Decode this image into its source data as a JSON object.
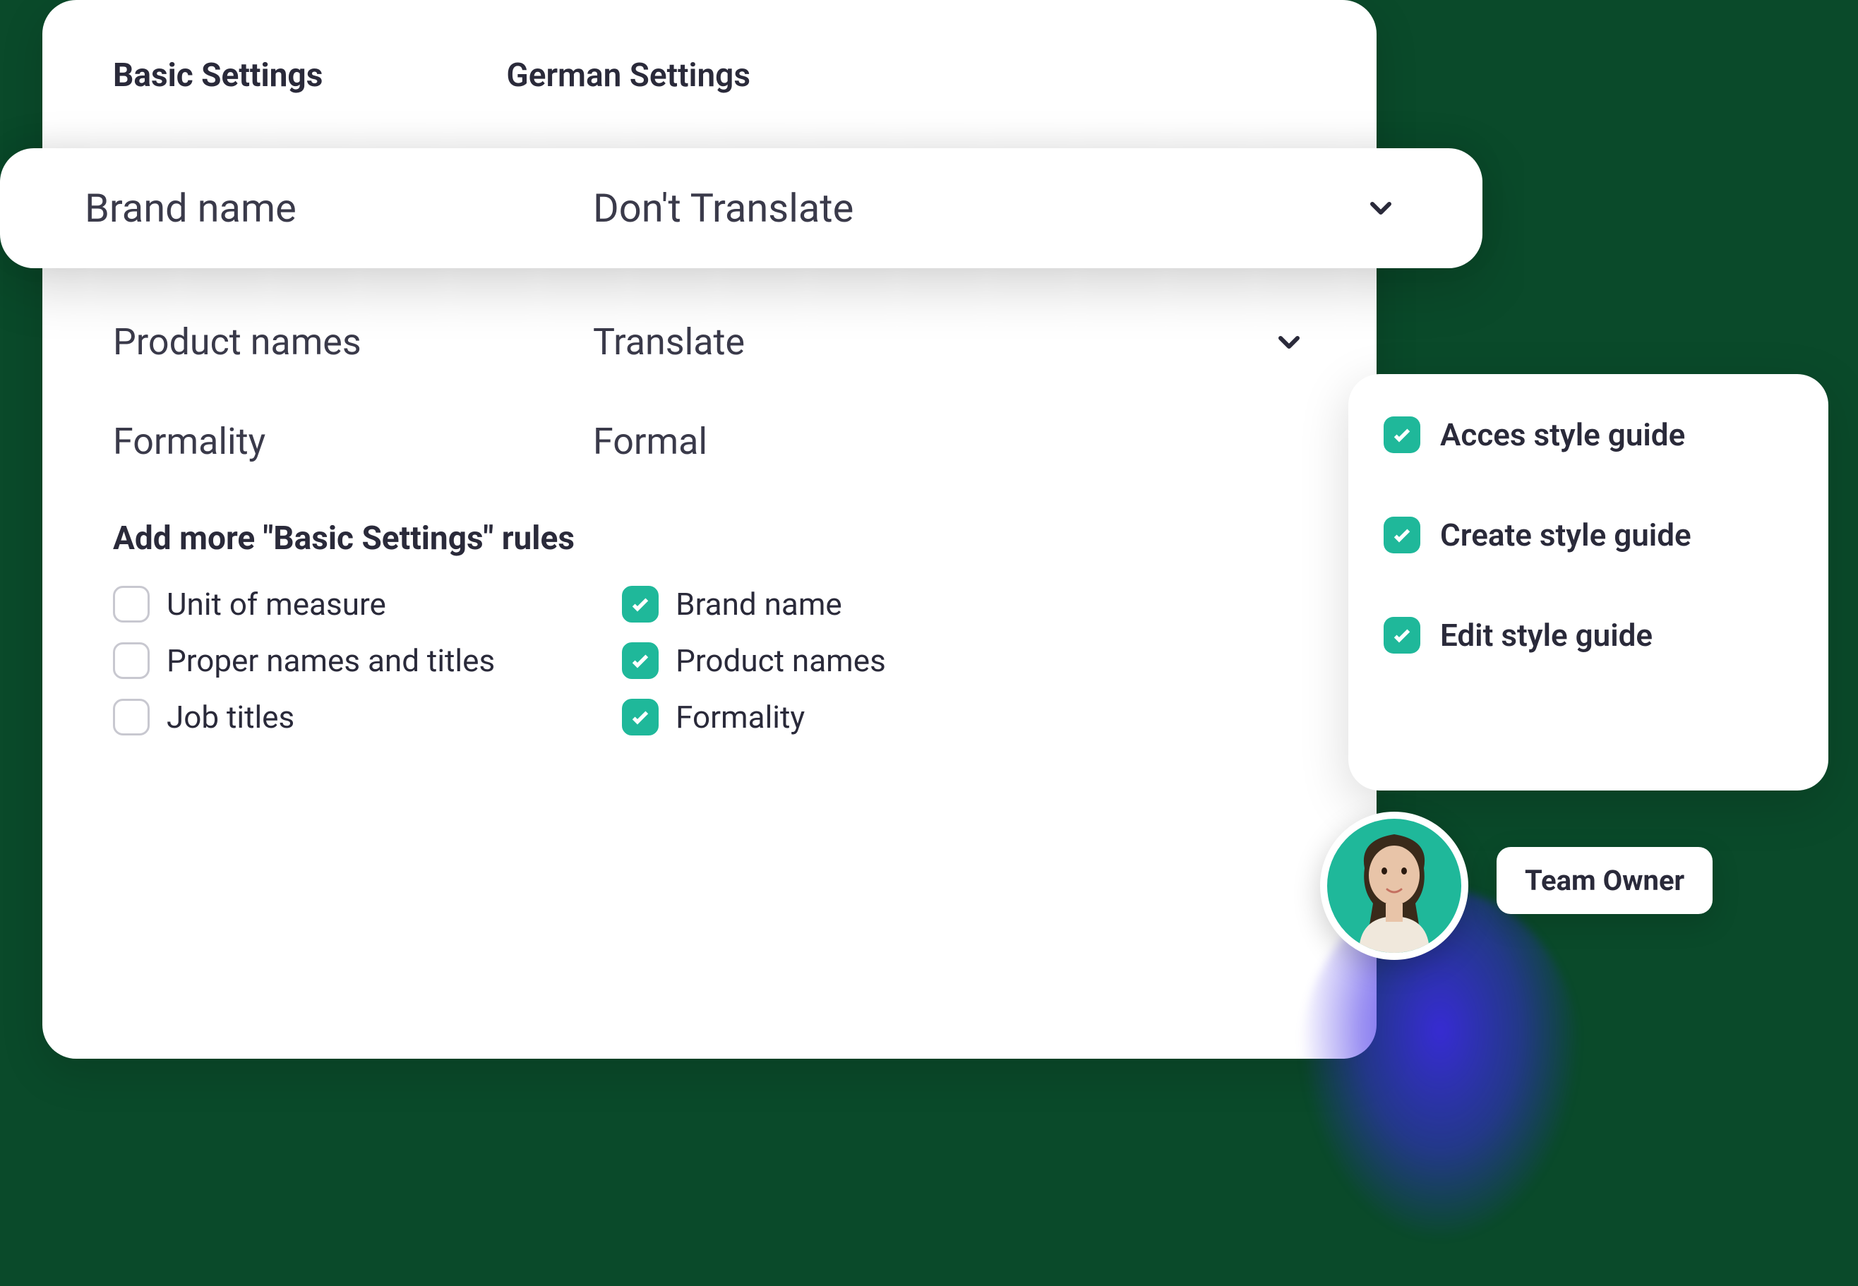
{
  "tabs": {
    "basic": "Basic Settings",
    "german": "German Settings"
  },
  "brand_row": {
    "label": "Brand name",
    "value": "Don't Translate"
  },
  "rows": [
    {
      "label": "Product names",
      "value": "Translate",
      "has_chevron": true
    },
    {
      "label": "Formality",
      "value": "Formal",
      "has_chevron": false
    }
  ],
  "section_title": "Add more \"Basic Settings\" rules",
  "rules": {
    "col1": [
      {
        "label": "Unit of measure",
        "checked": false
      },
      {
        "label": "Proper names and titles",
        "checked": false
      },
      {
        "label": "Job titles",
        "checked": false
      }
    ],
    "col2": [
      {
        "label": "Brand name",
        "checked": true
      },
      {
        "label": "Product names",
        "checked": true
      },
      {
        "label": "Formality",
        "checked": true
      }
    ]
  },
  "permissions": [
    {
      "label": "Acces style guide"
    },
    {
      "label": "Create style guide"
    },
    {
      "label": "Edit style guide"
    }
  ],
  "badge": "Team Owner",
  "colors": {
    "accent": "#1fb89a",
    "blob": "#3c28e6"
  }
}
